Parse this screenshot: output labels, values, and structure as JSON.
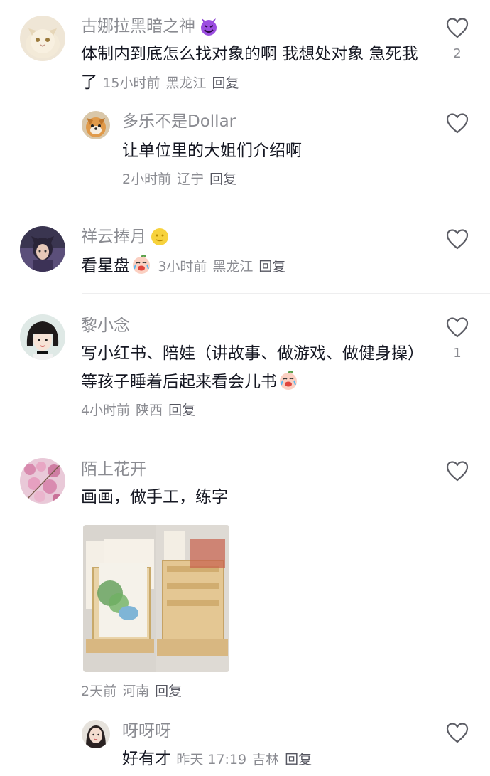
{
  "comments": [
    {
      "username": "古娜拉黑暗之神",
      "badge_icon": "smiling-devil-icon",
      "text": "体制内到底怎么找对象的啊 我想处对象 急死我了",
      "time": "15小时前",
      "location": "黑龙江",
      "reply_label": "回复",
      "like_count": "2"
    },
    {
      "username": "多乐不是Dollar",
      "text": "让单位里的大姐们介绍啊",
      "time": "2小时前",
      "location": "辽宁",
      "reply_label": "回复"
    },
    {
      "username": "祥云捧月",
      "badge_icon": "moon-face-icon",
      "text": "看星盘",
      "emoji_icon": "crying-laughing-peach-icon",
      "time": "3小时前",
      "location": "黑龙江",
      "reply_label": "回复"
    },
    {
      "username": "黎小念",
      "text": "写小红书、陪娃（讲故事、做游戏、做健身操）等孩子睡着后起来看会儿书",
      "emoji_icon": "crying-laughing-peach-icon",
      "time": "4小时前",
      "location": "陕西",
      "reply_label": "回复",
      "like_count": "1"
    },
    {
      "username": "陌上花开",
      "text": "画画，做手工，练字",
      "time": "2天前",
      "location": "河南",
      "reply_label": "回复",
      "image_description": "handmade-stand-photo"
    },
    {
      "username": "呀呀呀",
      "text": "好有才",
      "time": "昨天 17:19",
      "location": "吉林",
      "reply_label": "回复"
    }
  ],
  "colors": {
    "text_primary": "#161823",
    "text_secondary": "#8a8b91",
    "divider": "#eeeeef"
  }
}
